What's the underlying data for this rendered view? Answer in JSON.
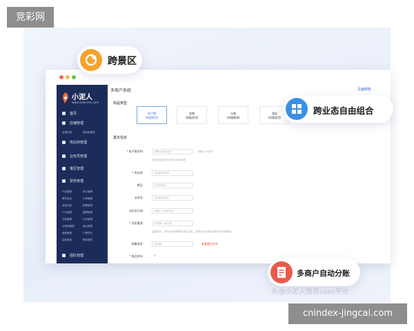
{
  "watermark_top": "竞彩网",
  "watermark_bottom": "cnindex-jingcai.com",
  "social_handle": "头@小泥人旅游saas平台",
  "badges": [
    {
      "label": "跨景区",
      "color": "#f6a32b"
    },
    {
      "label": "跨业态自由组合",
      "color": "#3b8fe6"
    },
    {
      "label": "多商户自动分账",
      "color": "#ea5b4c"
    }
  ],
  "app": {
    "logo_text": "小泥人",
    "logo_sub": "www.xiaoniren.com",
    "breadcrumb": "多商户系统",
    "top_right_link": "页面刷新"
  },
  "sidebar": {
    "items": [
      {
        "label": "首页"
      },
      {
        "label": "店铺管理"
      },
      {
        "label": "供应商管理"
      },
      {
        "label": "业务员管理"
      },
      {
        "label": "景区管理"
      },
      {
        "label": "票务管理"
      },
      {
        "label": "团队管理"
      }
    ],
    "sub_store": [
      "店铺列表",
      "新商家管理"
    ],
    "sub_ticket": [
      [
        "产品管理",
        "预订管理"
      ],
      [
        "票务验证",
        "订单管理"
      ],
      [
        "商品列表",
        "取票管理"
      ],
      [
        "OTA管理",
        "套票管理"
      ],
      [
        "分类管理",
        "打折管理"
      ],
      [
        "分销商管理",
        "营业报表"
      ],
      [
        "退款管理",
        "门票排行"
      ],
      [
        "结算报表",
        "票务报表"
      ]
    ]
  },
  "form": {
    "product_type_title": "商品类型",
    "tiles": [
      {
        "line1": "电子票",
        "line2": "(充值发货)",
        "active": true
      },
      {
        "line1": "实物",
        "line2": "(充值发货)",
        "active": false
      },
      {
        "line1": "卡卷",
        "line2": "(充值物流)",
        "active": false
      },
      {
        "line1": "酒店",
        "line2": "(充值发货)",
        "active": false
      }
    ],
    "basic_info_title": "基本信息",
    "rows": [
      {
        "label": "* 电子票名称:",
        "placeholder": "请输入商品名称",
        "hint": "该输入50字符"
      },
      {
        "label": "",
        "placeholder": "",
        "hint": "可自动显示商户名称与商品名称"
      },
      {
        "label": "* 供应商:",
        "placeholder": "请选择供应商",
        "hint": ""
      },
      {
        "label": "景区:",
        "placeholder": "请选择景区",
        "hint": ""
      },
      {
        "label": "业务员:",
        "placeholder": "请选择业务员",
        "hint": ""
      },
      {
        "label": "业务员分成:",
        "placeholder": "请输入分成百分比",
        "hint": ""
      },
      {
        "label": "* 适用渠道:",
        "placeholder": "请选择一级分类",
        "hint": ""
      },
      {
        "label": "",
        "placeholder": "",
        "hint": "温馨提示：须先在分类管理中建立分类，选择后可在商品列表中按分类筛选"
      },
      {
        "label": "结算类目:",
        "placeholder": "请选择",
        "red": "查看类目分布"
      },
      {
        "label": "* 商品库存:",
        "placeholder": "1",
        "hint": ""
      }
    ]
  }
}
